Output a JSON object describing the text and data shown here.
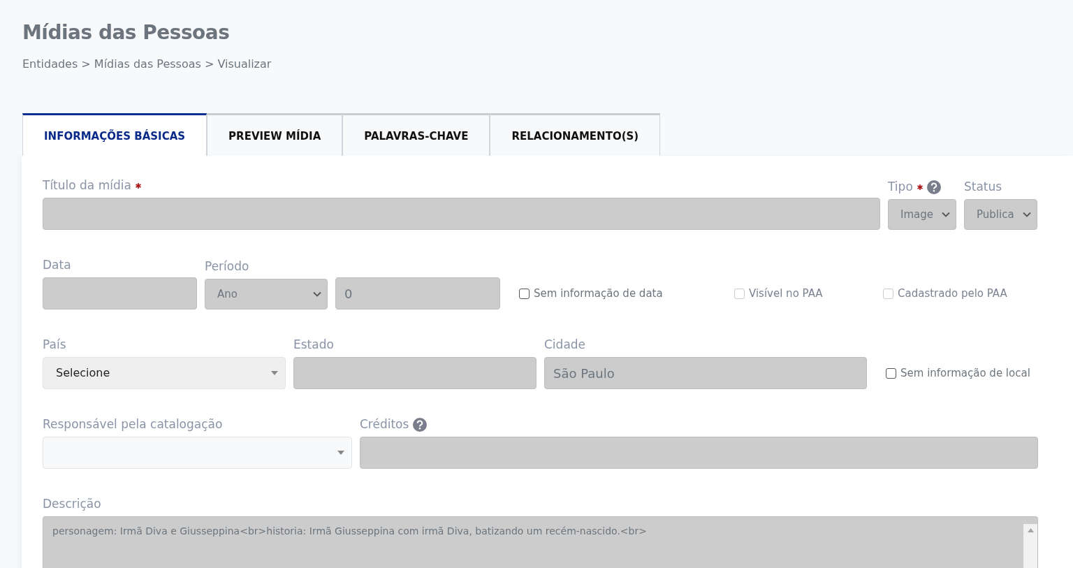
{
  "page": {
    "title": "Mídias das Pessoas",
    "breadcrumb": "Entidades > Mídias das Pessoas > Visualizar"
  },
  "tabs": [
    {
      "label": "INFORMAÇÕES BÁSICAS",
      "selected": true
    },
    {
      "label": "PREVIEW MÍDIA",
      "selected": false
    },
    {
      "label": "PALAVRAS-CHAVE",
      "selected": false
    },
    {
      "label": "RELACIONAMENTO(S)",
      "selected": false
    }
  ],
  "rows": [
    {
      "fields": [
        {
          "kind": "input",
          "label": "Título da mídia",
          "required": true,
          "disabled": true
        },
        {
          "kind": "select",
          "label": "Tipo",
          "required": true,
          "help": true,
          "value": "Image",
          "disabled": true
        },
        {
          "kind": "select",
          "label": "Status",
          "value": "Publica",
          "disabled": true
        }
      ]
    },
    {
      "fields": [
        {
          "kind": "input",
          "label": "Data",
          "disabled": true
        },
        {
          "kind": "select",
          "label": "Período",
          "value": "Ano",
          "disabled": true
        },
        {
          "kind": "input",
          "value": "0",
          "disabled": true
        },
        {
          "kind": "checkbox",
          "label": "Sem informação de data",
          "checked": false,
          "disabled": false
        },
        {
          "kind": "checkbox",
          "label": "Visível no PAA",
          "checked": false,
          "disabled": true
        },
        {
          "kind": "checkbox",
          "label": "Cadastrado pelo PAA",
          "checked": false,
          "disabled": true
        }
      ]
    },
    {
      "fields": [
        {
          "kind": "combo",
          "label": "País",
          "value": "Selecione",
          "disabled": false
        },
        {
          "kind": "input",
          "label": "Estado",
          "disabled": true
        },
        {
          "kind": "input",
          "label": "Cidade",
          "value": "São Paulo",
          "disabled": true
        },
        {
          "kind": "checkbox",
          "label": "Sem informação de local",
          "checked": false,
          "disabled": false
        }
      ]
    },
    {
      "fields": [
        {
          "kind": "combo",
          "label": "Responsável pela catalogação",
          "disabled": false
        },
        {
          "kind": "input",
          "label": "Créditos",
          "help": true,
          "disabled": true
        }
      ]
    },
    {
      "fields": [
        {
          "kind": "textarea",
          "label": "Descrição",
          "value": "personagem: Irmã Diva e Giusseppina<br>historia: Irmã Giusseppina com irmã Diva, batizando um recém-nascido.<br>",
          "disabled": true
        }
      ]
    }
  ]
}
